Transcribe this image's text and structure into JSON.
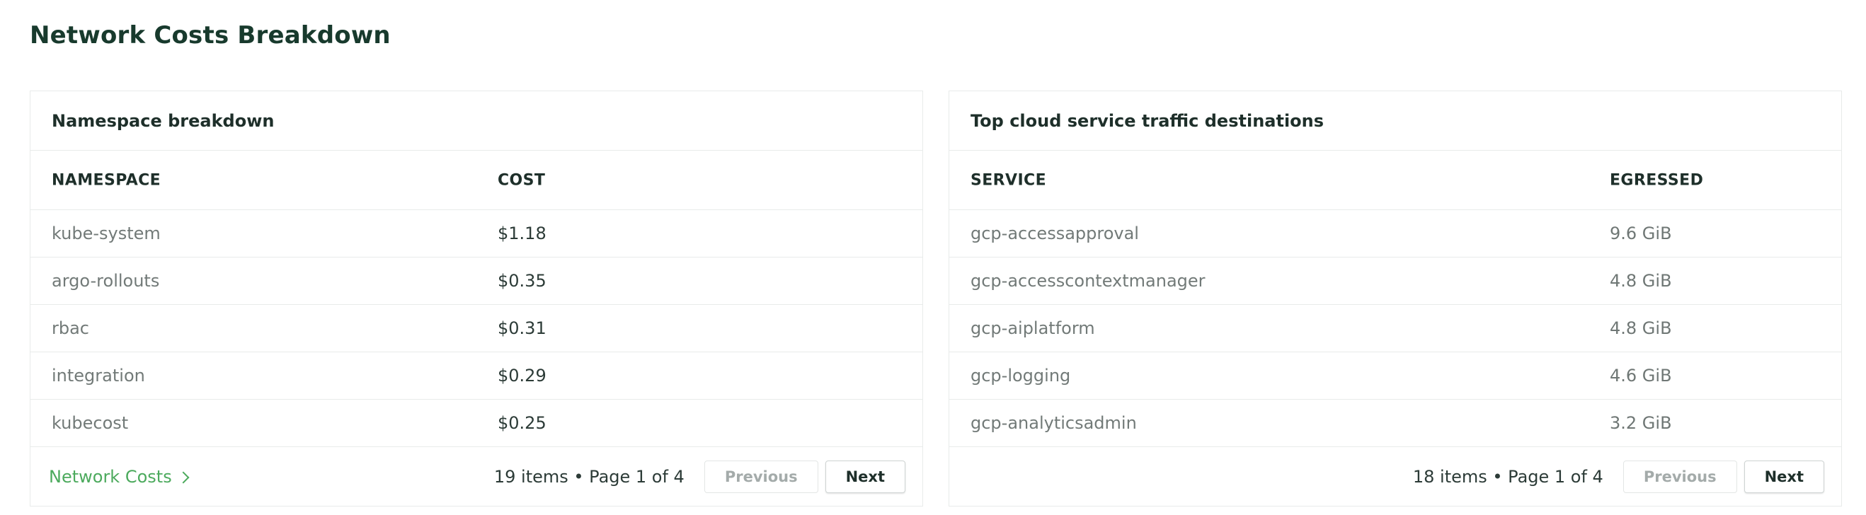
{
  "page": {
    "title": "Network Costs Breakdown"
  },
  "namespace_card": {
    "title": "Namespace breakdown",
    "columns": [
      "NAMESPACE",
      "COST"
    ],
    "rows": [
      {
        "name": "kube-system",
        "value": "$1.18"
      },
      {
        "name": "argo-rollouts",
        "value": "$0.35"
      },
      {
        "name": "rbac",
        "value": "$0.31"
      },
      {
        "name": "integration",
        "value": "$0.29"
      },
      {
        "name": "kubecost",
        "value": "$0.25"
      }
    ],
    "footer_link": "Network Costs",
    "page_info": "19 items • Page 1 of 4",
    "prev_label": "Previous",
    "next_label": "Next"
  },
  "services_card": {
    "title": "Top cloud service traffic destinations",
    "columns": [
      "SERVICE",
      "EGRESSED"
    ],
    "rows": [
      {
        "name": "gcp-accessapproval",
        "value": "9.6 GiB"
      },
      {
        "name": "gcp-accesscontextmanager",
        "value": "4.8 GiB"
      },
      {
        "name": "gcp-aiplatform",
        "value": "4.8 GiB"
      },
      {
        "name": "gcp-logging",
        "value": "4.6 GiB"
      },
      {
        "name": "gcp-analyticsadmin",
        "value": "3.2 GiB"
      }
    ],
    "page_info": "18 items • Page 1 of 4",
    "prev_label": "Previous",
    "next_label": "Next"
  },
  "colors": {
    "title": "#183a2d",
    "link": "#4caa5d",
    "border": "#e8ebea"
  },
  "icons": {
    "footer_link_icon": "chevron-right-icon"
  }
}
